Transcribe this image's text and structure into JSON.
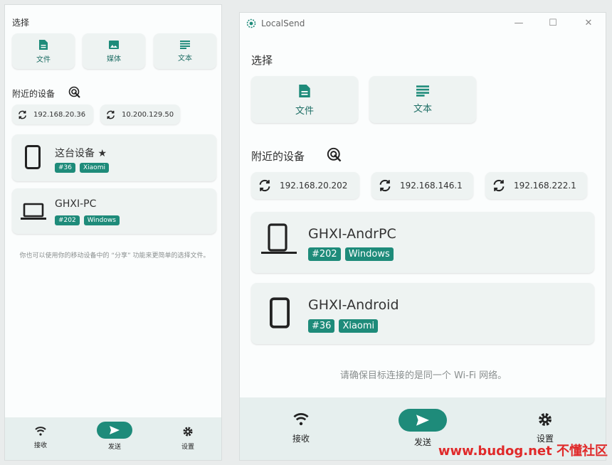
{
  "phone": {
    "section_select": "选择",
    "options": [
      {
        "label": "文件",
        "icon": "file-icon"
      },
      {
        "label": "媒体",
        "icon": "image-icon"
      },
      {
        "label": "文本",
        "icon": "text-icon"
      }
    ],
    "section_nearby": "附近的设备",
    "ips": [
      "192.168.20.36",
      "10.200.129.50"
    ],
    "devices": [
      {
        "name": "这台设备 ★",
        "tags": [
          "#36",
          "Xiaomi"
        ],
        "icon": "phone-icon"
      },
      {
        "name": "GHXI-PC",
        "tags": [
          "#202",
          "Windows"
        ],
        "icon": "laptop-icon"
      }
    ],
    "hint": "你也可以使用你的移动设备中的 “分享” 功能来更简单的选择文件。",
    "nav": {
      "receive": "接收",
      "send": "发送",
      "settings": "设置"
    }
  },
  "desktop": {
    "app_title": "LocalSend",
    "section_select": "选择",
    "options": [
      {
        "label": "文件",
        "icon": "file-icon"
      },
      {
        "label": "文本",
        "icon": "text-icon"
      }
    ],
    "section_nearby": "附近的设备",
    "ips": [
      "192.168.20.202",
      "192.168.146.1",
      "192.168.222.1"
    ],
    "devices": [
      {
        "name": "GHXI-AndrPC",
        "tags": [
          "#202",
          "Windows"
        ],
        "icon": "phone-laptop-icon"
      },
      {
        "name": "GHXI-Android",
        "tags": [
          "#36",
          "Xiaomi"
        ],
        "icon": "phone-icon"
      }
    ],
    "hint": "请确保目标连接的是同一个 Wi-Fi 网络。",
    "nav": {
      "receive": "接收",
      "send": "发送",
      "settings": "设置"
    }
  },
  "watermark": "www.budog.net 不懂社区",
  "colors": {
    "accent": "#1e8b7a",
    "card": "#eef3f2",
    "navbar": "#e6efee"
  }
}
